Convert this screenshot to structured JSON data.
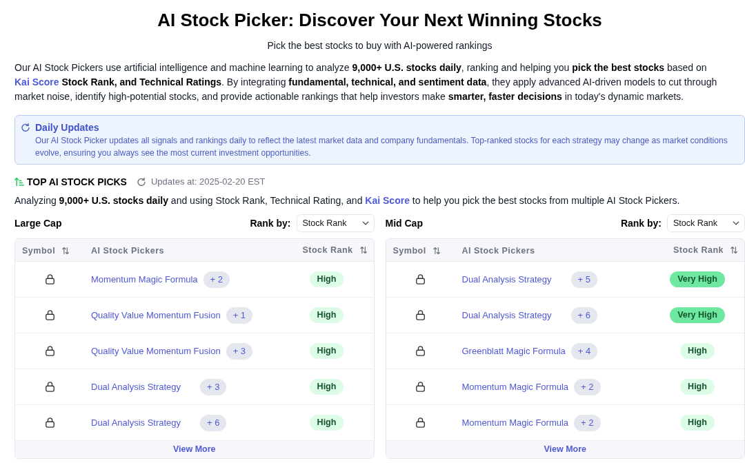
{
  "header": {
    "title": "AI Stock Picker: Discover Your Next Winning Stocks",
    "subtitle": "Pick the best stocks to buy with AI-powered rankings"
  },
  "intro": {
    "before": "Our AI Stock Pickers use artificial intelligence and machine learning to analyze **9,000+ U.S. stocks daily**, ranking and helping you **pick the best stocks** based on",
    "link": "Kai Score",
    "after": "**Stock Rank, and Technical Ratings**. By integrating **fundamental, technical, and sentiment data**, they apply advanced AI-driven models to cut through market noise, identify high-potential stocks, and provide actionable rankings that help investors make **smarter, faster decisions** in today's dynamic markets."
  },
  "notice": {
    "title": "Daily Updates",
    "text": "Our AI Stock Picker updates all signals and rankings daily to reflect the latest market data and company fundamentals. Top-ranked stocks for each strategy may change as market conditions evolve, ensuring you always see the most current investment opportunities."
  },
  "picks": {
    "title": "TOP AI STOCK PICKS",
    "updated": "Updates at: 2025-02-20 EST",
    "summary": {
      "before": "Analyzing **9,000+ U.S. stocks daily** and using Stock Rank, Technical Rating, and",
      "link": "Kai Score",
      "after": "to help you pick the best stocks from multiple AI Stock Pickers."
    }
  },
  "tables": [
    {
      "title": "Large Cap",
      "rank_by_label": "Rank by:",
      "rank_by_value": "Stock Rank",
      "columns": [
        {
          "label": "Symbol",
          "sortable": true
        },
        {
          "label": "AI Stock Pickers",
          "sortable": false
        },
        {
          "label": "Stock Rank",
          "sortable": true
        }
      ],
      "rows": [
        {
          "picker": "Momentum Magic Formula",
          "more": "+ 2",
          "rank": "High",
          "color": "#dcfce7"
        },
        {
          "picker": "Quality Value Momentum Fusion",
          "more": "+ 1",
          "rank": "High",
          "color": "#dcfce7"
        },
        {
          "picker": "Quality Value Momentum Fusion",
          "more": "+ 3",
          "rank": "High",
          "color": "#dcfce7"
        },
        {
          "picker": "Dual Analysis Strategy",
          "more": "+ 3",
          "rank": "High",
          "color": "#dcfce7"
        },
        {
          "picker": "Dual Analysis Strategy",
          "more": "+ 6",
          "rank": "High",
          "color": "#dcfce7"
        }
      ],
      "view_more": "View More"
    },
    {
      "title": "Mid Cap",
      "rank_by_label": "Rank by:",
      "rank_by_value": "Stock Rank",
      "columns": [
        {
          "label": "Symbol",
          "sortable": true
        },
        {
          "label": "AI Stock Pickers",
          "sortable": false
        },
        {
          "label": "Stock Rank",
          "sortable": true
        }
      ],
      "rows": [
        {
          "picker": "Dual Analysis Strategy",
          "more": "+ 5",
          "rank": "Very High",
          "color": "#6ee7a0"
        },
        {
          "picker": "Dual Analysis Strategy",
          "more": "+ 6",
          "rank": "Very High",
          "color": "#6ee7a0"
        },
        {
          "picker": "Greenblatt Magic Formula",
          "more": "+ 4",
          "rank": "High",
          "color": "#dcfce7"
        },
        {
          "picker": "Momentum Magic Formula",
          "more": "+ 2",
          "rank": "High",
          "color": "#dcfce7"
        },
        {
          "picker": "Momentum Magic Formula",
          "more": "+ 2",
          "rank": "High",
          "color": "#dcfce7"
        }
      ],
      "view_more": "View More"
    }
  ]
}
